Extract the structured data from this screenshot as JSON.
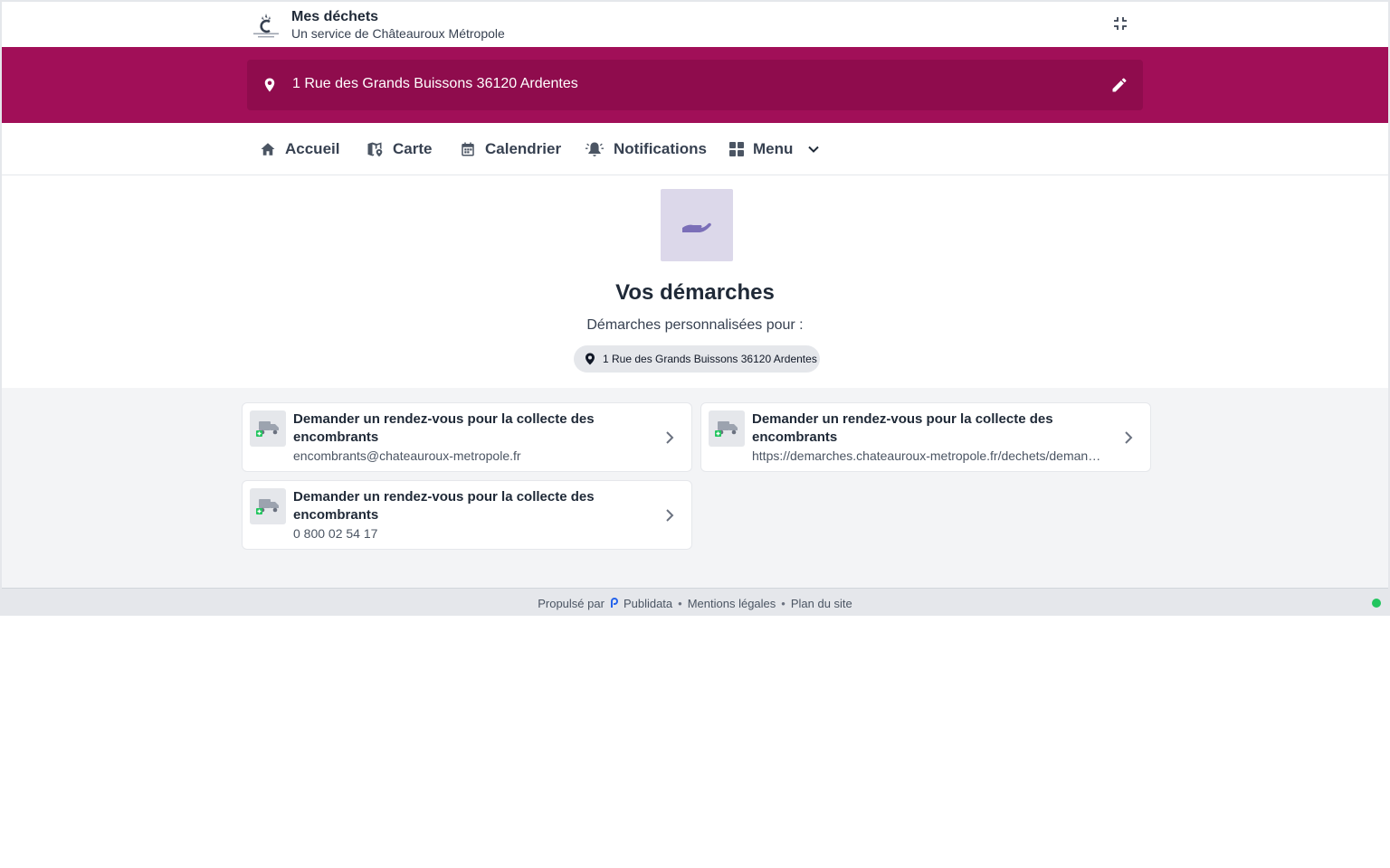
{
  "header": {
    "logo_text": "CHÂTEAUROUX MÉTROPOLE",
    "title": "Mes déchets",
    "subtitle": "Un service de Châteauroux Métropole"
  },
  "address_bar": {
    "address": "1 Rue des Grands Buissons 36120 Ardentes"
  },
  "nav": {
    "items": [
      {
        "label": "Accueil",
        "icon": "home-icon"
      },
      {
        "label": "Carte",
        "icon": "map-pin-icon"
      },
      {
        "label": "Calendrier",
        "icon": "calendar-icon"
      },
      {
        "label": "Notifications",
        "icon": "bell-icon"
      },
      {
        "label": "Menu",
        "icon": "grid-icon"
      }
    ]
  },
  "main": {
    "title": "Vos démarches",
    "subtitle": "Démarches personnalisées pour :",
    "address_chip": "1 Rue des Grands Buissons 36120 Ardentes"
  },
  "cards": [
    {
      "title": "Demander un rendez-vous pour la collecte des encombrants",
      "detail": "encombrants@chateauroux-metropole.fr"
    },
    {
      "title": "Demander un rendez-vous pour la collecte des encombrants",
      "detail": "https://demarches.chateauroux-metropole.fr/dechets/demande-de-collecte-des-encombrants"
    },
    {
      "title": "Demander un rendez-vous pour la collecte des encombrants",
      "detail": "0 800 02 54 17"
    }
  ],
  "footer": {
    "powered_by": "Propulsé par",
    "brand": "Publidata",
    "legal": "Mentions légales",
    "sitemap": "Plan du site",
    "separator": "•"
  },
  "colors": {
    "brand": "#a10f58",
    "brand_dark": "#8f0c4d",
    "hero_icon_bg": "#dcd8ea",
    "hero_icon": "#7b6fb8",
    "truck_badge": "#22c55e",
    "status": "#22c55e"
  }
}
